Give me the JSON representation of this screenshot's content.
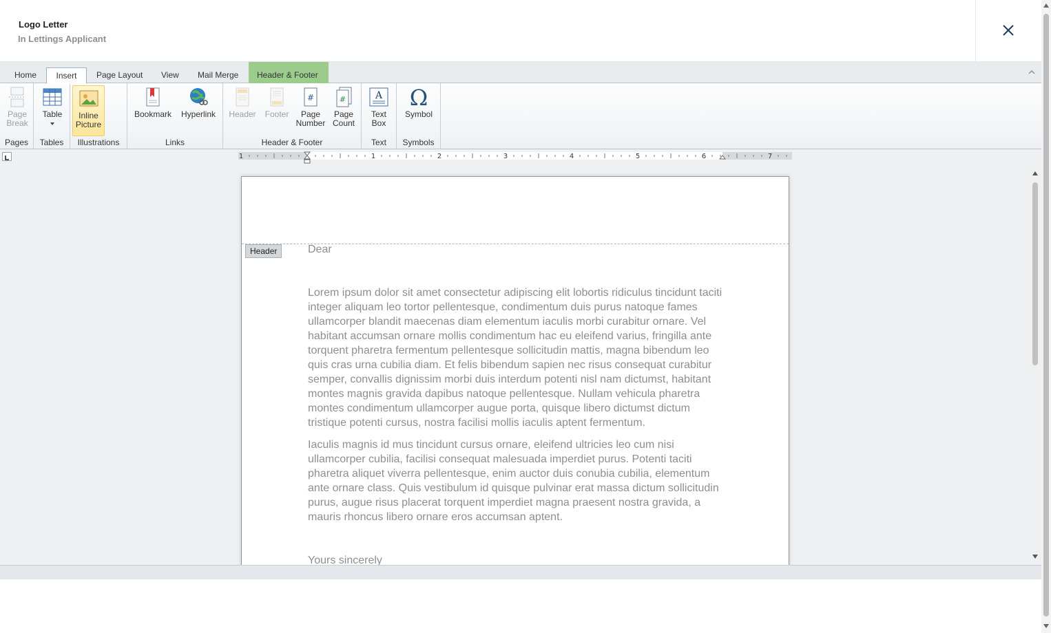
{
  "window": {
    "title": "Logo Letter",
    "subtitle": "In Lettings Applicant"
  },
  "tabs": [
    {
      "label": "Home"
    },
    {
      "label": "Insert"
    },
    {
      "label": "Page Layout"
    },
    {
      "label": "View"
    },
    {
      "label": "Mail Merge"
    },
    {
      "label": "Header & Footer"
    }
  ],
  "active_tab": "Insert",
  "ribbon": {
    "groups": {
      "pages": "Pages",
      "tables": "Tables",
      "illustrations": "Illustrations",
      "links": "Links",
      "header_footer": "Header & Footer",
      "text": "Text",
      "symbols": "Symbols"
    },
    "buttons": {
      "page_break": [
        "Page",
        "Break"
      ],
      "table": "Table",
      "inline_picture": [
        "Inline",
        "Picture"
      ],
      "bookmark": "Bookmark",
      "hyperlink": "Hyperlink",
      "header": "Header",
      "footer": "Footer",
      "page_number": [
        "Page",
        "Number"
      ],
      "page_count": [
        "Page",
        "Count"
      ],
      "text_box": [
        "Text",
        "Box"
      ],
      "symbol": "Symbol"
    }
  },
  "ruler": {
    "numbers": [
      "1",
      "1",
      "2",
      "3",
      "4",
      "5",
      "6",
      "7"
    ]
  },
  "document": {
    "header_tag": "Header",
    "salutation": "Dear",
    "paragraph1": "Lorem ipsum dolor sit amet consectetur adipiscing elit lobortis ridiculus tincidunt taciti integer aliquam leo tortor pellentesque, condimentum duis purus natoque fames ullamcorper blandit maecenas diam elementum iaculis morbi curabitur ornare. Vel habitant accumsan ornare mollis condimentum hac eu eleifend varius, fringilla ante torquent pharetra fermentum pellentesque sollicitudin mattis, magna bibendum leo quis cras urna cubilia diam. Et felis bibendum sapien nec risus consequat curabitur semper, convallis dignissim morbi duis interdum potenti nisl nam dictumst, habitant montes magnis gravida dapibus natoque pellentesque. Nullam vehicula pharetra montes condimentum ullamcorper augue porta, quisque libero dictumst dictum tristique potenti cursus, nostra facilisi mollis iaculis aptent fermentum.",
    "paragraph2": "Iaculis magnis id mus tincidunt cursus ornare, eleifend ultricies leo cum nisi ullamcorper cubilia, facilisi consequat malesuada imperdiet purus. Potenti taciti pharetra aliquet viverra pellentesque, enim auctor duis conubia cubilia, elementum ante ornare class. Quis vestibulum id quisque pulvinar erat massa dictum sollicitudin purus, augue risus placerat torquent imperdiet magna praesent nostra gravida, a mauris rhoncus libero ornare eros accumsan aptent.",
    "closing": "Yours sincerely"
  },
  "colors": {
    "accent_context_tab": "#9ccc8c",
    "body_text": "#8b8f93"
  }
}
